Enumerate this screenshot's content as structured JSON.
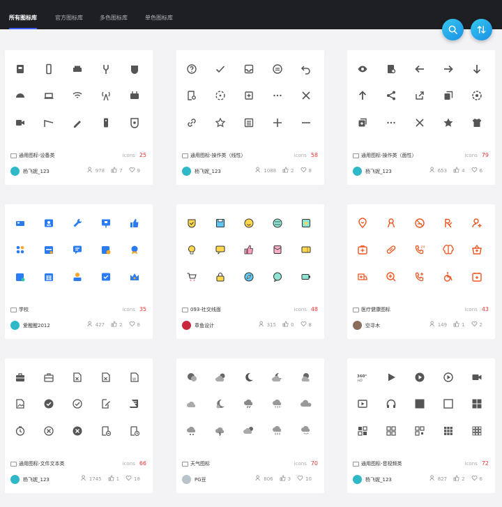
{
  "nav": {
    "tabs": [
      {
        "label": "所有图标库",
        "active": true
      },
      {
        "label": "官方图标库",
        "active": false
      },
      {
        "label": "多色图标库",
        "active": false
      },
      {
        "label": "单色图标库",
        "active": false
      }
    ]
  },
  "actions": {
    "search_icon": "search-icon",
    "sort_icon": "sort-icon"
  },
  "colors": {
    "accent": "#3b5cf0",
    "fab": "#1a8fe6",
    "count": "#e33333",
    "gray_icon": "#555555",
    "orange_icon": "#f0541e",
    "blue_icon": "#2b7cf0"
  },
  "cards": [
    {
      "name": "通用图标-设备类",
      "icons_label": "icons",
      "count": "25",
      "author": "杨飞妮_123",
      "stats": {
        "members": "978",
        "likes": "7",
        "favorites": "9"
      }
    },
    {
      "name": "通用图标-操作类（线性）",
      "icons_label": "icons",
      "count": "58",
      "author": "杨飞妮_123",
      "stats": {
        "members": "1088",
        "likes": "2",
        "favorites": "8"
      }
    },
    {
      "name": "通用图标-操作类（面性）",
      "icons_label": "icons",
      "count": "79",
      "author": "杨飞妮_123",
      "stats": {
        "members": "653",
        "likes": "4",
        "favorites": "6"
      }
    },
    {
      "name": "学校",
      "icons_label": "icons",
      "count": "35",
      "author": "爱醒醒2012",
      "stats": {
        "members": "427",
        "likes": "2",
        "favorites": "8"
      }
    },
    {
      "name": "093-社交线面",
      "icons_label": "icons",
      "count": "48",
      "author": "章鱼设计",
      "stats": {
        "members": "315",
        "likes": "0",
        "favorites": "8"
      }
    },
    {
      "name": "医疗健康图标",
      "icons_label": "icons",
      "count": "43",
      "author": "空寻木",
      "stats": {
        "members": "149",
        "likes": "1",
        "favorites": "2"
      }
    },
    {
      "name": "通用图标-文件文本类",
      "icons_label": "icons",
      "count": "66",
      "author": "杨飞妮_123",
      "stats": {
        "members": "1745",
        "likes": "1",
        "favorites": "18"
      }
    },
    {
      "name": "天气图标",
      "icons_label": "icons",
      "count": "70",
      "author": "PG豆",
      "stats": {
        "members": "806",
        "likes": "3",
        "favorites": "10"
      }
    },
    {
      "name": "通用图标-音视频类",
      "icons_label": "icons",
      "count": "72",
      "author": "杨飞妮_123",
      "stats": {
        "members": "827",
        "likes": "2",
        "favorites": "6"
      }
    }
  ]
}
